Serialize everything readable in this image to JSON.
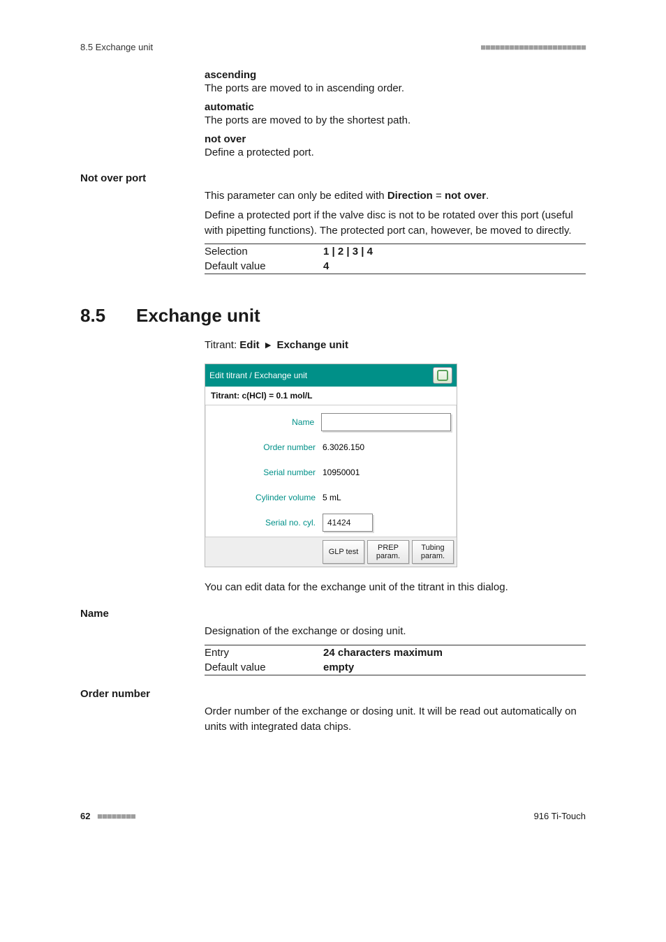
{
  "header": {
    "section_ref": "8.5 Exchange unit",
    "dashes": "■■■■■■■■■■■■■■■■■■■■■■"
  },
  "intro_terms": [
    {
      "term": "ascending",
      "desc": "The ports are moved to in ascending order."
    },
    {
      "term": "automatic",
      "desc": "The ports are moved to by the shortest path."
    },
    {
      "term": "not over",
      "desc": "Define a protected port."
    }
  ],
  "not_over": {
    "heading": "Not over port",
    "line1_pre": "This parameter can only be edited with ",
    "line1_b1": "Direction",
    "line1_mid": " = ",
    "line1_b2": "not over",
    "line1_post": ".",
    "para": "Define a protected port if the valve disc is not to be rotated over this port (useful with pipetting functions). The protected port can, however, be moved to directly.",
    "rows": [
      {
        "label": "Selection",
        "value": "1 | 2 | 3 | 4"
      },
      {
        "label": "Default value",
        "value": "4"
      }
    ]
  },
  "section": {
    "num": "8.5",
    "title": "Exchange unit",
    "crumb_prefix": "Titrant: ",
    "crumb_b1": "Edit",
    "crumb_sep": "▶",
    "crumb_b2": "Exchange unit"
  },
  "dialog": {
    "title": "Edit titrant / Exchange unit",
    "subtitle": "Titrant: c(HCl) = 0.1 mol/L",
    "fields": {
      "name": {
        "label": "Name",
        "value": ""
      },
      "order": {
        "label": "Order number",
        "value": "6.3026.150"
      },
      "serial": {
        "label": "Serial number",
        "value": "10950001"
      },
      "cyl": {
        "label": "Cylinder volume",
        "value": "5 mL"
      },
      "serialcyl": {
        "label": "Serial no. cyl.",
        "value": "41424"
      }
    },
    "buttons": {
      "glp": "GLP test",
      "prep": "PREP param.",
      "tubing": "Tubing param."
    }
  },
  "after_dialog": "You can edit data for the exchange unit of the titrant in this dialog.",
  "name_block": {
    "heading": "Name",
    "desc": "Designation of the exchange or dosing unit.",
    "rows": [
      {
        "label": "Entry",
        "value": "24 characters maximum"
      },
      {
        "label": "Default value",
        "value": "empty"
      }
    ]
  },
  "order_block": {
    "heading": "Order number",
    "desc": "Order number of the exchange or dosing unit. It will be read out automatically on units with integrated data chips."
  },
  "footer": {
    "page": "62",
    "dashes": "■■■■■■■■",
    "product": "916 Ti‑Touch"
  }
}
